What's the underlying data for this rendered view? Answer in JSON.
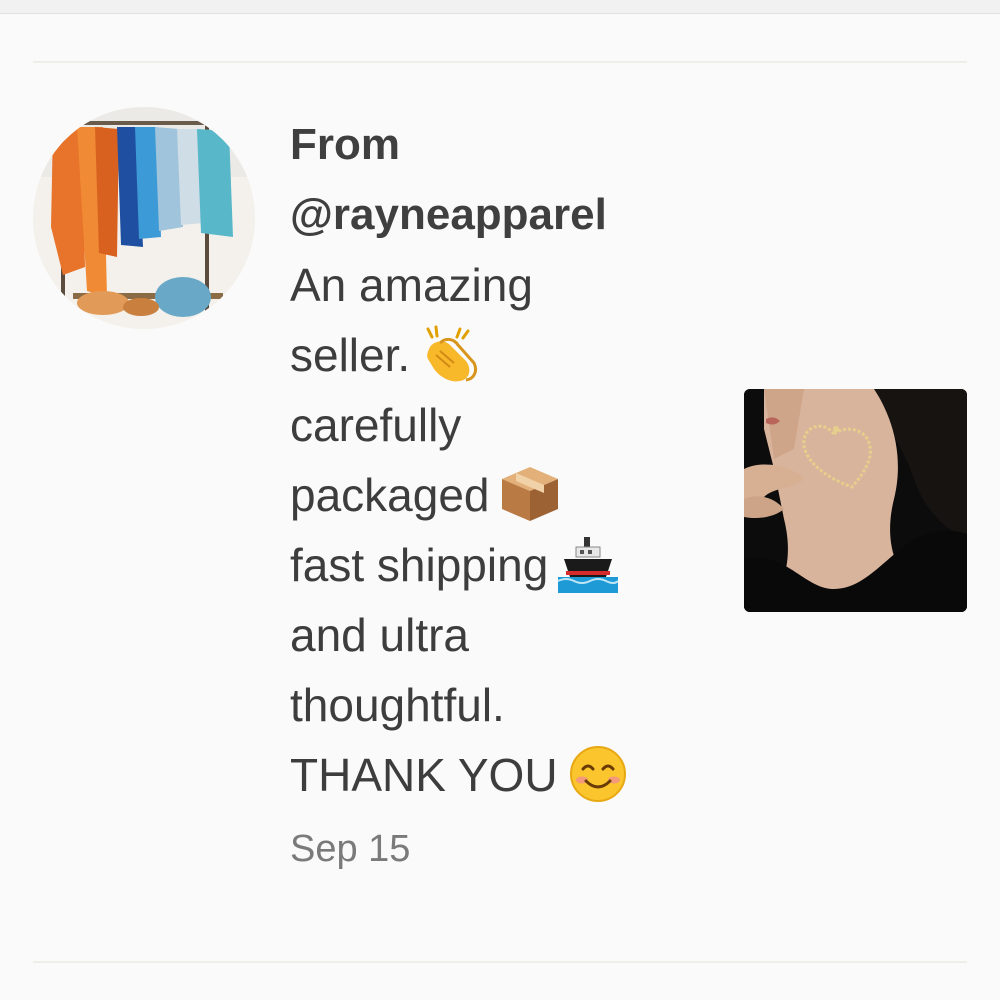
{
  "review": {
    "from_prefix": "From",
    "username": "@rayneapparel",
    "lines": [
      {
        "text": "An amazing",
        "emoji": ""
      },
      {
        "text": "seller.",
        "emoji": "clapping-hands"
      },
      {
        "text": "carefully",
        "emoji": ""
      },
      {
        "text": "packaged",
        "emoji": "package"
      },
      {
        "text": "fast shipping",
        "emoji": "ship"
      },
      {
        "text": "and ultra",
        "emoji": ""
      },
      {
        "text": "thoughtful.",
        "emoji": ""
      },
      {
        "text": "THANK YOU",
        "emoji": "smiling-face"
      }
    ],
    "date": "Sep 15"
  },
  "colors": {
    "text": "#3f3f3f",
    "date": "#7a7a7a",
    "background": "#fafafa",
    "divider": "#efefe8"
  }
}
